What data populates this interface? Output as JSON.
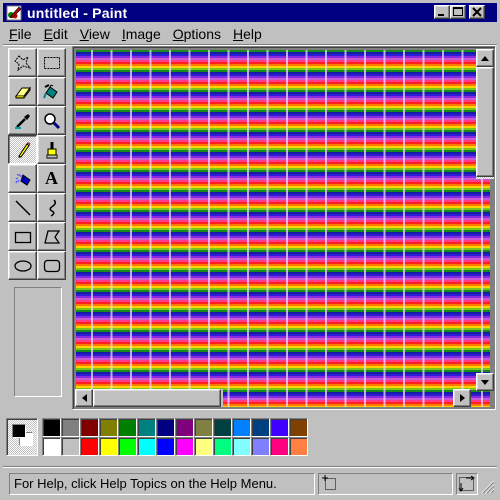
{
  "window": {
    "title": "untitled - Paint",
    "app_icon": "paint-icon",
    "controls": {
      "minimize_icon": "minimize-icon",
      "maximize_icon": "maximize-icon",
      "close_icon": "close-icon"
    }
  },
  "menu": {
    "items": [
      {
        "label": "File",
        "accel": "F",
        "rest": "ile"
      },
      {
        "label": "Edit",
        "accel": "E",
        "rest": "dit"
      },
      {
        "label": "View",
        "accel": "V",
        "rest": "iew"
      },
      {
        "label": "Image",
        "accel": "I",
        "rest": "mage"
      },
      {
        "label": "Options",
        "accel": "O",
        "rest": "ptions"
      },
      {
        "label": "Help",
        "accel": "H",
        "rest": "elp"
      }
    ]
  },
  "toolbox": {
    "tools": [
      {
        "name": "free-form-select",
        "icon": "free-form-select-icon"
      },
      {
        "name": "select",
        "icon": "rect-select-icon"
      },
      {
        "name": "eraser",
        "icon": "eraser-icon"
      },
      {
        "name": "fill-with-color",
        "icon": "paint-bucket-icon"
      },
      {
        "name": "pick-color",
        "icon": "eyedropper-icon"
      },
      {
        "name": "magnifier",
        "icon": "magnifier-icon"
      },
      {
        "name": "pencil",
        "icon": "pencil-icon",
        "active": true
      },
      {
        "name": "brush",
        "icon": "brush-icon"
      },
      {
        "name": "airbrush",
        "icon": "airbrush-icon"
      },
      {
        "name": "text",
        "icon": "text-icon",
        "glyph": "A"
      },
      {
        "name": "line",
        "icon": "line-icon"
      },
      {
        "name": "curve",
        "icon": "curve-icon"
      },
      {
        "name": "rectangle",
        "icon": "rectangle-icon"
      },
      {
        "name": "polygon",
        "icon": "polygon-icon"
      },
      {
        "name": "ellipse",
        "icon": "ellipse-icon"
      },
      {
        "name": "rounded-rectangle",
        "icon": "rounded-rectangle-icon"
      }
    ],
    "active_tool": "pencil"
  },
  "canvas": {
    "stripe_colors": [
      "#1a8a1a",
      "#1a1aa8",
      "#2b1fd0",
      "#8a2be2",
      "#c85ad8",
      "#ff3a8a",
      "#ff2020",
      "#ff7a00",
      "#ffd200",
      "#7ac81a"
    ],
    "grid_line_color": "#f0d8ff"
  },
  "scrollbars": {
    "vertical": {
      "up_icon": "arrow-up-icon",
      "down_icon": "arrow-down-icon",
      "position": 0
    },
    "horizontal": {
      "left_icon": "arrow-left-icon",
      "right_icon": "arrow-right-icon",
      "position": 0
    }
  },
  "palette": {
    "foreground": "#000000",
    "background": "#ffffff",
    "colors_top": [
      "#000000",
      "#808080",
      "#800000",
      "#808000",
      "#008000",
      "#008080",
      "#000080",
      "#800080",
      "#808040",
      "#004040",
      "#0080ff",
      "#004080",
      "#4000ff",
      "#804000"
    ],
    "colors_bottom": [
      "#ffffff",
      "#c0c0c0",
      "#ff0000",
      "#ffff00",
      "#00ff00",
      "#00ffff",
      "#0000ff",
      "#ff00ff",
      "#ffff80",
      "#00ff80",
      "#80ffff",
      "#8080ff",
      "#ff0080",
      "#ff8040"
    ]
  },
  "status": {
    "help_text": "For Help, click Help Topics on the Help Menu.",
    "position_icon": "cursor-position-icon",
    "size_icon": "selection-size-icon",
    "grip_icon": "resize-grip-icon"
  }
}
